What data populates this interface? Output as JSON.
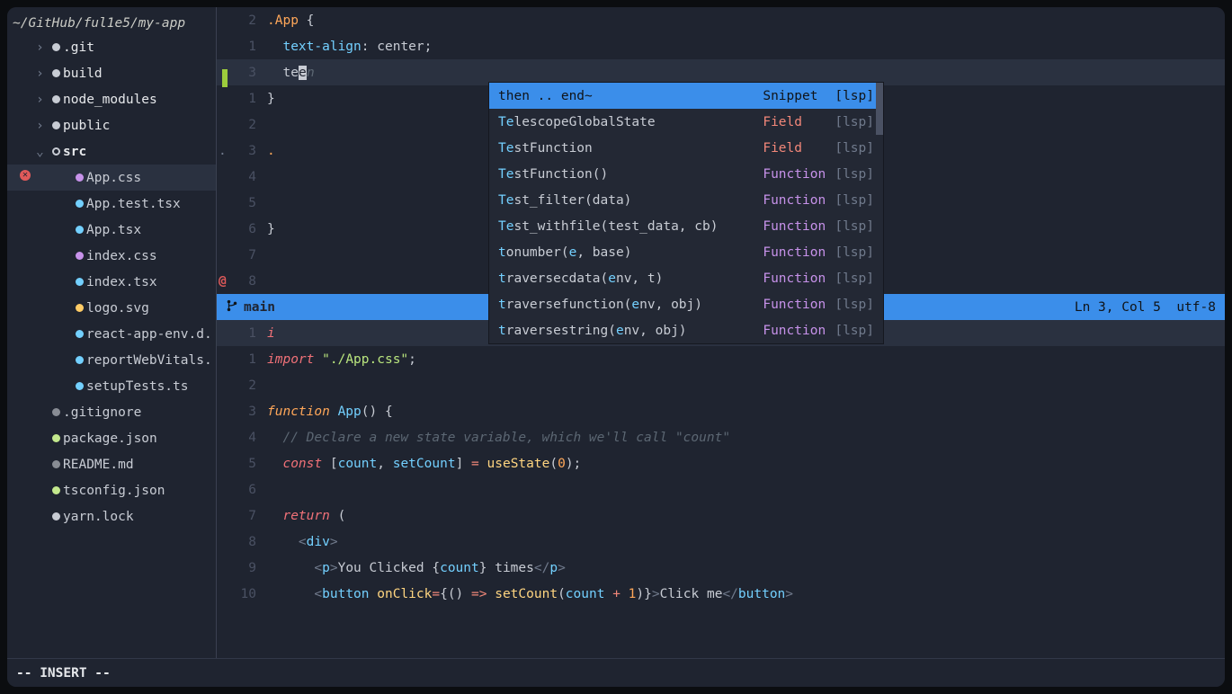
{
  "sidebar": {
    "root": "~/GitHub/ful1e5/my-app",
    "items": [
      {
        "name": ".git",
        "kind": "folder",
        "chevron": "›",
        "indent": 1,
        "dotColor": "#c8ccd4"
      },
      {
        "name": "build",
        "kind": "folder",
        "chevron": "›",
        "indent": 1,
        "dotColor": "#c8ccd4"
      },
      {
        "name": "node_modules",
        "kind": "folder",
        "chevron": "›",
        "indent": 1,
        "dotColor": "#c8ccd4"
      },
      {
        "name": "public",
        "kind": "folder",
        "chevron": "›",
        "indent": 1,
        "dotColor": "#c8ccd4"
      },
      {
        "name": "src",
        "kind": "folder",
        "chevron": "⌄",
        "indent": 1,
        "open": true,
        "bold": true
      },
      {
        "name": "App.css",
        "kind": "file",
        "indent": 2,
        "dotColor": "#c792ea",
        "active": true,
        "error": true
      },
      {
        "name": "App.test.tsx",
        "kind": "file",
        "indent": 2,
        "dotColor": "#73d0ff"
      },
      {
        "name": "App.tsx",
        "kind": "file",
        "indent": 2,
        "dotColor": "#73d0ff"
      },
      {
        "name": "index.css",
        "kind": "file",
        "indent": 2,
        "dotColor": "#c792ea"
      },
      {
        "name": "index.tsx",
        "kind": "file",
        "indent": 2,
        "dotColor": "#73d0ff"
      },
      {
        "name": "logo.svg",
        "kind": "file",
        "indent": 2,
        "dotColor": "#ffcc66"
      },
      {
        "name": "react-app-env.d.",
        "kind": "file",
        "indent": 2,
        "dotColor": "#73d0ff"
      },
      {
        "name": "reportWebVitals.",
        "kind": "file",
        "indent": 2,
        "dotColor": "#73d0ff"
      },
      {
        "name": "setupTests.ts",
        "kind": "file",
        "indent": 2,
        "dotColor": "#73d0ff"
      },
      {
        "name": ".gitignore",
        "kind": "file",
        "indent": 1,
        "dotColor": "#888c94"
      },
      {
        "name": "package.json",
        "kind": "file",
        "indent": 1,
        "dotColor": "#c3e88d"
      },
      {
        "name": "README.md",
        "kind": "file",
        "indent": 1,
        "dotColor": "#888c94"
      },
      {
        "name": "tsconfig.json",
        "kind": "file",
        "indent": 1,
        "dotColor": "#c3e88d"
      },
      {
        "name": "yarn.lock",
        "kind": "file",
        "indent": 1,
        "dotColor": "#c8ccd4"
      }
    ]
  },
  "top_pane": {
    "lines": [
      {
        "num": "2",
        "rel": false
      },
      {
        "num": "1",
        "rel": true
      },
      {
        "num": "3",
        "rel": false,
        "cursor": true,
        "sign": "add",
        "hl": true
      },
      {
        "num": "1",
        "rel": true
      },
      {
        "num": "2",
        "rel": true
      },
      {
        "num": "3",
        "rel": true,
        "dot": true
      },
      {
        "num": "4",
        "rel": true
      },
      {
        "num": "5",
        "rel": true
      },
      {
        "num": "6",
        "rel": true
      },
      {
        "num": "7",
        "rel": true
      },
      {
        "num": "8",
        "rel": true,
        "diff": "@"
      }
    ],
    "typed_prefix": "te",
    "typed_suffix": "en"
  },
  "completion": {
    "items": [
      {
        "label_a": "then .. end~",
        "label_b": "",
        "kind": "Snippet",
        "kindClass": "c-white",
        "src": "[lsp]",
        "selected": true
      },
      {
        "label_a": "Te",
        "label_b": "lescopeGlobalState",
        "kind": "Field",
        "kindClass": "c-field",
        "src": "[lsp]"
      },
      {
        "label_a": "Te",
        "label_b": "stFunction",
        "kind": "Field",
        "kindClass": "c-field",
        "src": "[lsp]"
      },
      {
        "label_a": "Te",
        "label_b": "stFunction()",
        "kind": "Function",
        "kindClass": "c-function",
        "src": "[lsp]"
      },
      {
        "label_a": "Te",
        "label_b": "st_filter(data)",
        "kind": "Function",
        "kindClass": "c-function",
        "src": "[lsp]"
      },
      {
        "label_a": "Te",
        "label_b": "st_withfile(test_data, cb)",
        "kind": "Function",
        "kindClass": "c-function",
        "src": "[lsp]"
      },
      {
        "label_a": "t",
        "label_b1": "onumber(",
        "label_e": "e",
        "label_b2": ", base)",
        "kind": "Function",
        "kindClass": "c-function",
        "src": "[lsp]"
      },
      {
        "label_a": "t",
        "label_b1": "raversecdata(",
        "label_e": "e",
        "label_b2": "nv, t)",
        "kind": "Function",
        "kindClass": "c-function",
        "src": "[lsp]"
      },
      {
        "label_a": "t",
        "label_b1": "raversefunction(",
        "label_e": "e",
        "label_b2": "nv, obj)",
        "kind": "Function",
        "kindClass": "c-function",
        "src": "[lsp]"
      },
      {
        "label_a": "t",
        "label_b1": "raversestring(",
        "label_e": "e",
        "label_b2": "nv, obj)",
        "kind": "Function",
        "kindClass": "c-function",
        "src": "[lsp]"
      }
    ]
  },
  "statusline": {
    "branch": "main",
    "position": "Ln 3, Col 5",
    "encoding": "utf-8"
  },
  "bottom_pane": {
    "lines": [
      {
        "num": "1"
      },
      {
        "num": "1"
      },
      {
        "num": "2"
      },
      {
        "num": "3"
      },
      {
        "num": "4"
      },
      {
        "num": "5"
      },
      {
        "num": "6"
      },
      {
        "num": "7"
      },
      {
        "num": "8"
      },
      {
        "num": "9"
      },
      {
        "num": "10"
      }
    ],
    "code": {
      "l1_import": "import",
      "l1_str": "\"./App.css\"",
      "l3_fn": "function",
      "l3_name": "App",
      "l4_comment": "// Declare a new state variable, which we'll call \"count\"",
      "l5_const": "const",
      "l5_count": "count",
      "l5_setCount": "setCount",
      "l5_useState": "useState",
      "l5_zero": "0",
      "l7_return": "return",
      "l8_div": "div",
      "l9_p": "p",
      "l9_text": "You Clicked ",
      "l9_count": "count",
      "l9_text2": " times",
      "l10_button": "button",
      "l10_onClick": "onClick",
      "l10_arrow": "=>",
      "l10_setCount": "setCount",
      "l10_count": "count",
      "l10_plus": "+",
      "l10_one": "1",
      "l10_text": "Click me"
    }
  },
  "cmdline": {
    "mode": "-- INSERT --"
  },
  "css_code": {
    "l1_sel": ".App",
    "l2_prop": "text-align",
    "l2_val": "center",
    "l3_close": "}",
    "l4_close": "}",
    "l5_sel2": ".",
    "l7_close": "}"
  }
}
